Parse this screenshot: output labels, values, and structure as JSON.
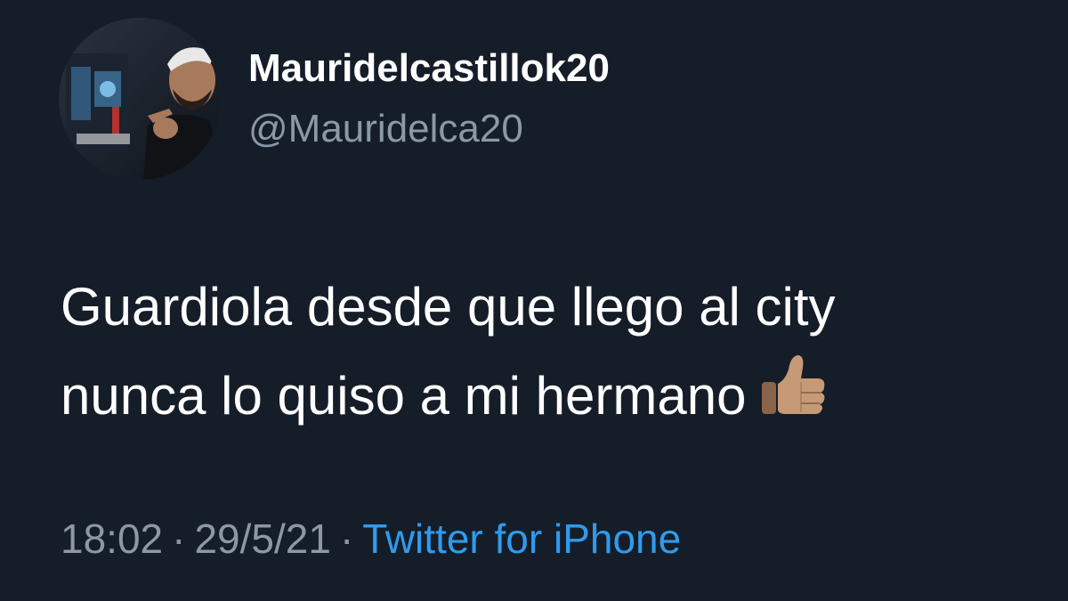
{
  "user": {
    "display_name": "Mauridelcastillok20",
    "handle": "@Mauridelca20",
    "avatar_icon": "profile-photo"
  },
  "tweet": {
    "lines": [
      "Guardiola desde que llego al city",
      "nunca lo quiso a mi hermano"
    ],
    "emoji": "thumbs-up-icon"
  },
  "meta": {
    "time": "18:02",
    "separator": "·",
    "date": "29/5/21",
    "source": "Twitter for iPhone"
  },
  "colors": {
    "background": "#151d28",
    "primary_text": "#ffffff",
    "secondary_text": "#8b98a6",
    "link": "#2f9bee"
  }
}
